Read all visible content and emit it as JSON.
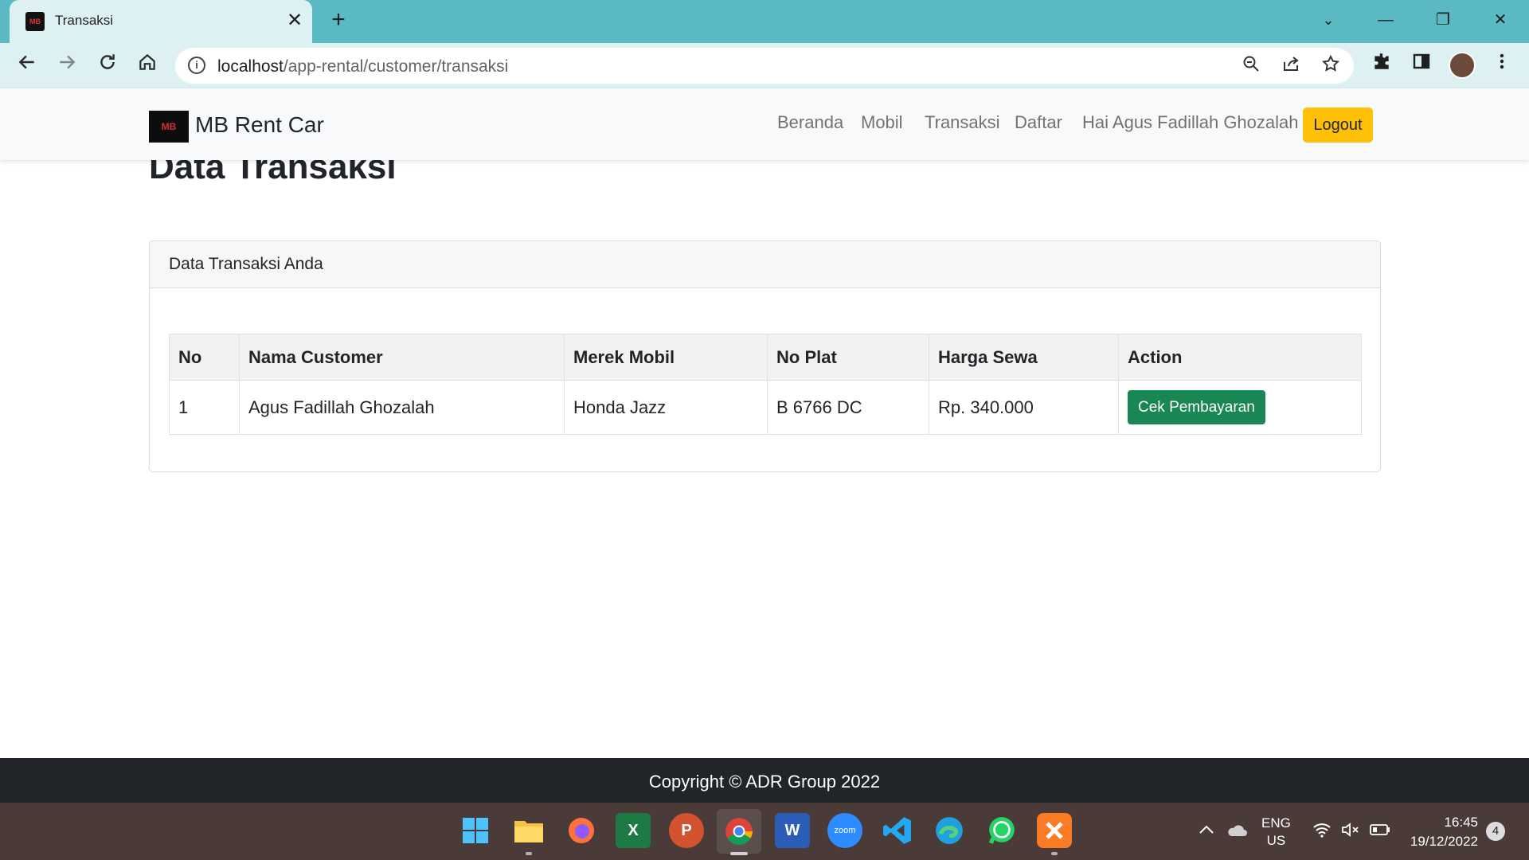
{
  "browser": {
    "tab_title": "Transaksi",
    "tab_close": "✕",
    "new_tab": "+",
    "url_host": "localhost",
    "url_path": "/app-rental/customer/transaksi",
    "window_controls": {
      "minimize": "—",
      "restore": "❐",
      "close": "✕",
      "tab_search": "⌄"
    }
  },
  "navbar": {
    "brand_logo_text": "MB",
    "brand": "MB Rent Car",
    "links": [
      "Beranda",
      "Mobil",
      "Transaksi",
      "Daftar"
    ],
    "greeting": "Hai Agus Fadillah Ghozalah",
    "logout": "Logout",
    "logout_color": "#ffc107"
  },
  "page": {
    "heading": "Data Transaksi",
    "card_title": "Data Transaksi Anda"
  },
  "table": {
    "headers": [
      "No",
      "Nama Customer",
      "Merek Mobil",
      "No Plat",
      "Harga Sewa",
      "Action"
    ],
    "rows": [
      {
        "no": "1",
        "nama_customer": "Agus Fadillah Ghozalah",
        "merek_mobil": "Honda Jazz",
        "no_plat": "B 6766 DC",
        "harga_sewa": "Rp. 340.000",
        "action": "Cek Pembayaran"
      }
    ],
    "action_color": "#198754"
  },
  "footer": {
    "copyright": "Copyright © ADR Group 2022"
  },
  "taskbar": {
    "apps": [
      "start-icon",
      "file-explorer-icon",
      "firefox-icon",
      "excel-icon",
      "powerpoint-icon",
      "chrome-icon",
      "word-icon",
      "zoom-icon",
      "vscode-icon",
      "edge-icon",
      "whatsapp-icon",
      "xampp-icon"
    ],
    "app_labels": {
      "excel": "X",
      "powerpoint": "P",
      "word": "W",
      "zoom": "zoom"
    },
    "language_top": "ENG",
    "language_bottom": "US",
    "time": "16:45",
    "date": "19/12/2022",
    "notification_count": "4"
  }
}
